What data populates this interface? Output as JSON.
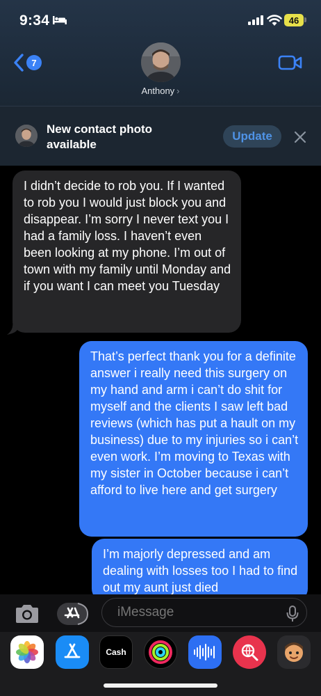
{
  "status": {
    "time": "9:34",
    "battery": "46"
  },
  "header": {
    "back_count": "7",
    "contact_name": "Anthony",
    "name_chevron": "›"
  },
  "banner": {
    "text": "New contact photo available",
    "update_label": "Update"
  },
  "messages": [
    {
      "direction": "incoming",
      "text": "I didn’t decide to rob you. If I wanted to rob you I would just block you and disappear. I’m sorry I never text you I had a family loss.  I haven’t even been looking at my phone. I’m out of town with my family until Monday and if you want I can meet you Tuesday"
    },
    {
      "direction": "outgoing",
      "text": "That’s perfect thank you for a definite answer i really need this surgery on my hand and arm i can’t do shit for myself and the clients I saw left bad reviews (which has put a hault  on my business) due to my injuries so i can’t even work. I’m moving to Texas with my sister in October because i can’t afford to live here and get surgery"
    },
    {
      "direction": "outgoing",
      "text": "I’m majorly depressed and am dealing with losses too I had to find out my aunt just died"
    }
  ],
  "composer": {
    "placeholder": "iMessage"
  },
  "apps": [
    {
      "name": "photos-app-icon"
    },
    {
      "name": "app-store-icon"
    },
    {
      "name": "apple-cash-icon",
      "label": "Cash"
    },
    {
      "name": "activity-icon"
    },
    {
      "name": "audio-message-icon"
    },
    {
      "name": "search-images-icon"
    },
    {
      "name": "memoji-icon"
    }
  ],
  "colors": {
    "incoming_bubble": "#262628",
    "outgoing_bubble": "#3478f6",
    "accent": "#3b82f6"
  }
}
